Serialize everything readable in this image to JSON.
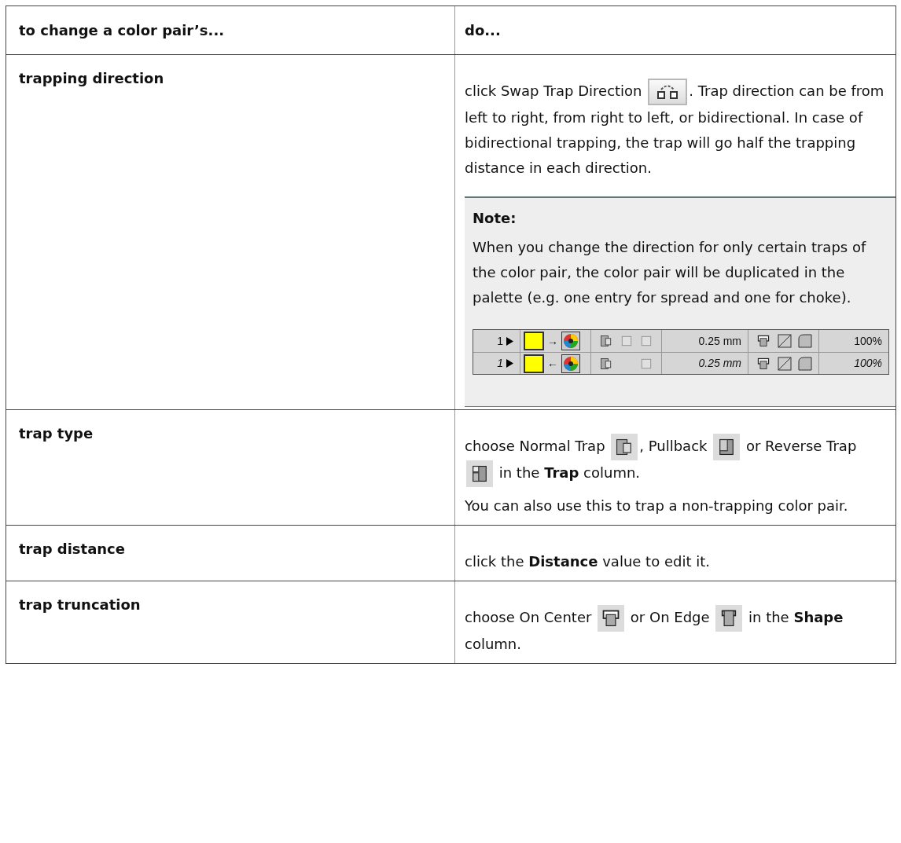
{
  "table": {
    "columns": [
      "to change a color pair’s...",
      "do..."
    ],
    "rows": [
      {
        "property": "trapping direction",
        "paragraphs": [
          [
            {
              "kind": "text",
              "text": "click Swap Trap Direction "
            },
            {
              "kind": "swap-button"
            },
            {
              "kind": "text",
              "text": ". Trap direction can be from left to right, from right to left, or bidirectional. In case of bidirectional trapping, the trap will go half the trapping distance in each direction."
            }
          ]
        ],
        "note": {
          "title": "Note:",
          "text": "When you change the direction for only certain traps of the color pair, the color pair will be duplicated in the palette (e.g. one entry for spread and one for choke).",
          "palette": [
            {
              "number": "1",
              "arrow": "→",
              "traps": [
                {
                  "kind": "normal"
                },
                {
                  "kind": "empty"
                },
                {
                  "kind": "empty"
                }
              ],
              "distance": "0.25 mm",
              "opacity": "100%",
              "modified": false
            },
            {
              "number": "1",
              "arrow": "←",
              "traps": [
                {
                  "kind": "normal"
                },
                {
                  "kind": "none"
                },
                {
                  "kind": "empty"
                }
              ],
              "distance": "0.25 mm",
              "opacity": "100%",
              "modified": true
            }
          ]
        }
      },
      {
        "property": "trap type",
        "paragraphs": [
          [
            {
              "kind": "text",
              "text": "choose Normal Trap "
            },
            {
              "kind": "normal-trap"
            },
            {
              "kind": "text",
              "text": ", Pullback "
            },
            {
              "kind": "pullback"
            },
            {
              "kind": "text",
              "text": " or Reverse Trap "
            },
            {
              "kind": "reverse-trap"
            },
            {
              "kind": "text",
              "text": " in the **Trap** column."
            }
          ],
          [
            {
              "kind": "text",
              "text": "You can also use this to trap a non-trapping color pair."
            }
          ]
        ]
      },
      {
        "property": "trap distance",
        "paragraphs": [
          [
            {
              "kind": "text",
              "text": "click the **Distance** value to edit it."
            }
          ]
        ]
      },
      {
        "property": "trap truncation",
        "paragraphs": [
          [
            {
              "kind": "text",
              "text": "choose On Center "
            },
            {
              "kind": "on-center"
            },
            {
              "kind": "text",
              "text": " or On Edge "
            },
            {
              "kind": "on-edge"
            },
            {
              "kind": "text",
              "text": " in the **Shape** column."
            }
          ]
        ]
      }
    ]
  }
}
